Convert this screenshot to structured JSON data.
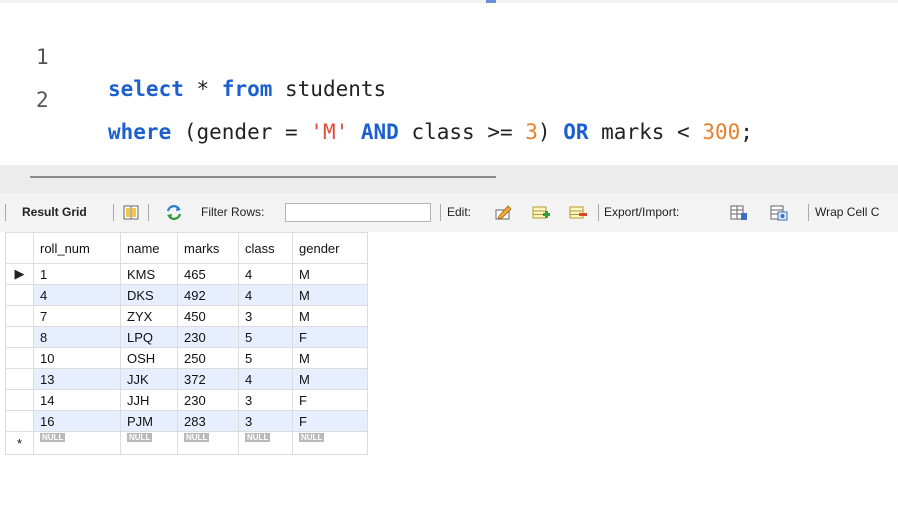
{
  "editor": {
    "lines": [
      {
        "number": "1",
        "kw1": "select",
        "t1": " * ",
        "kw2": "from",
        "t2": " students"
      },
      {
        "number": "2",
        "kw1": "where",
        "t1": " (gender = ",
        "str": "'M'",
        "t2": " ",
        "kw2": "AND",
        "t3": " class >= ",
        "num1": "3",
        "t4": ") ",
        "kw3": "OR",
        "t5": " marks < ",
        "num2": "300",
        "t6": ";"
      }
    ]
  },
  "toolbar": {
    "result_grid": "Result Grid",
    "filter_rows": "Filter Rows:",
    "filter_value": "",
    "edit": "Edit:",
    "export_import": "Export/Import:",
    "wrap_cell": "Wrap Cell C"
  },
  "grid": {
    "columns": [
      "roll_num",
      "name",
      "marks",
      "class",
      "gender"
    ],
    "rows": [
      [
        "1",
        "KMS",
        "465",
        "4",
        "M"
      ],
      [
        "4",
        "DKS",
        "492",
        "4",
        "M"
      ],
      [
        "7",
        "ZYX",
        "450",
        "3",
        "M"
      ],
      [
        "8",
        "LPQ",
        "230",
        "5",
        "F"
      ],
      [
        "10",
        "OSH",
        "250",
        "5",
        "M"
      ],
      [
        "13",
        "JJK",
        "372",
        "4",
        "M"
      ],
      [
        "14",
        "JJH",
        "230",
        "3",
        "F"
      ],
      [
        "16",
        "PJM",
        "283",
        "3",
        "F"
      ]
    ],
    "null_label": "NULL",
    "current_row_marker": "▶",
    "new_row_marker": "*"
  },
  "colors": {
    "keyword": "#1c5fd0",
    "string": "#e04b3b",
    "number": "#e5812c",
    "alt_row": "#e7efff"
  }
}
